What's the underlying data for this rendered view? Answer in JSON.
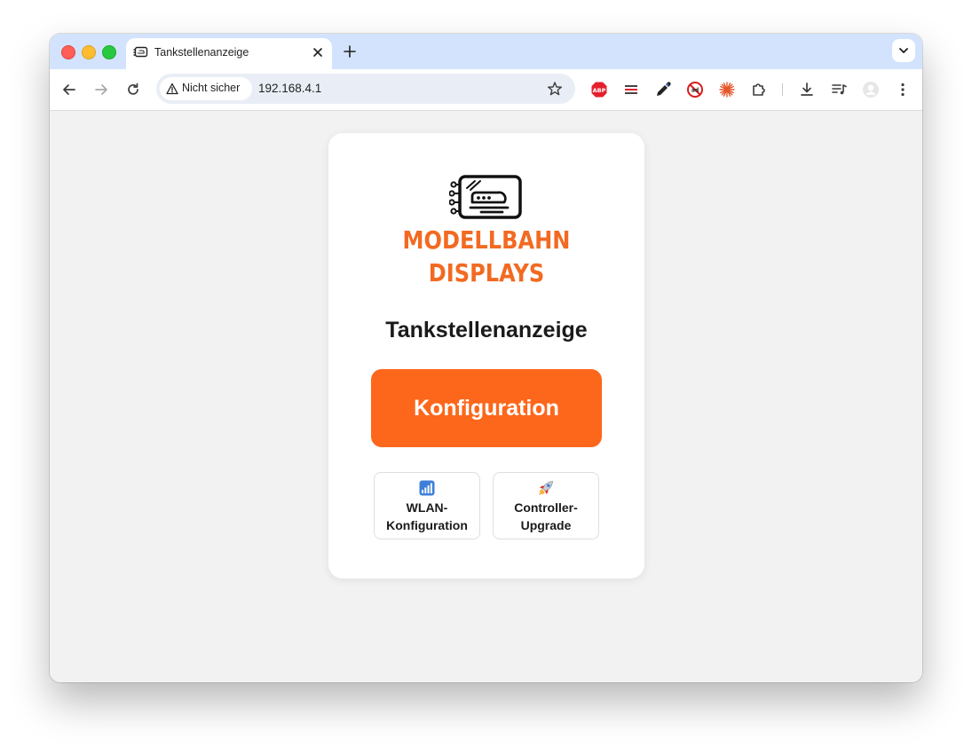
{
  "browser": {
    "tab_title": "Tankstellenanzeige",
    "security_label": "Nicht sicher",
    "url": "192.168.4.1"
  },
  "page": {
    "brand_line1": "MODELLBAHN",
    "brand_line2": "DISPLAYS",
    "title": "Tankstellenanzeige",
    "primary_button": "Konfiguration",
    "buttons": [
      {
        "label": "WLAN-\nKonfiguration",
        "icon": "signal-bars-icon"
      },
      {
        "label": "Controller-\nUpgrade",
        "icon": "rocket-icon"
      }
    ]
  },
  "colors": {
    "accent": "#fd671b",
    "brand_text": "#f26a21",
    "tabstrip": "#d3e3fd",
    "page_bg": "#f2f2f2"
  },
  "icons": {
    "window_controls": [
      "close-window-icon",
      "minimize-window-icon",
      "zoom-window-icon"
    ],
    "nav": [
      "back-arrow-icon",
      "forward-arrow-icon",
      "reload-icon"
    ],
    "extensions": [
      "adblock-plus-icon",
      "tab-list-icon",
      "eyedropper-icon",
      "block-ads-icon",
      "burst-icon",
      "puzzle-extensions-icon",
      "download-icon",
      "reading-list-icon",
      "profile-avatar-icon",
      "kebab-menu-icon"
    ]
  }
}
